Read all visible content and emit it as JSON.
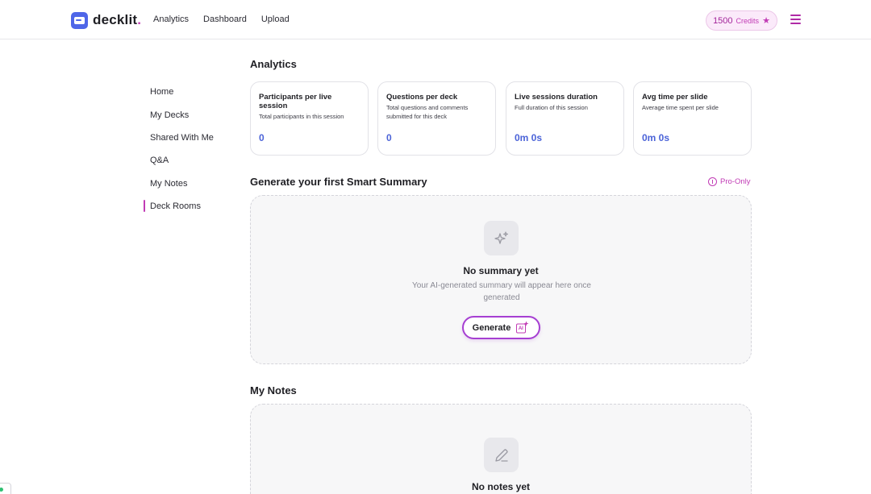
{
  "header": {
    "logo_text": "decklit",
    "logo_dot": ".",
    "nav": [
      "Analytics",
      "Dashboard",
      "Upload"
    ],
    "credits_value": "1500",
    "credits_label": "Credits"
  },
  "sidebar": {
    "items": [
      {
        "label": "Home"
      },
      {
        "label": "My Decks"
      },
      {
        "label": "Shared With Me"
      },
      {
        "label": "Q&A"
      },
      {
        "label": "My Notes"
      },
      {
        "label": "Deck Rooms"
      }
    ],
    "active_index": 5
  },
  "analytics": {
    "title": "Analytics",
    "cards": [
      {
        "title": "Participants per live session",
        "desc": "Total participants in this session",
        "value": "0"
      },
      {
        "title": "Questions per deck",
        "desc": "Total questions and comments submitted for this deck",
        "value": "0"
      },
      {
        "title": "Live sessions duration",
        "desc": "Full duration of this session",
        "value": "0m 0s"
      },
      {
        "title": "Avg time per slide",
        "desc": "Average time spent per slide",
        "value": "0m 0s"
      }
    ]
  },
  "summary": {
    "title": "Generate your first Smart Summary",
    "pro_label": "Pro-Only",
    "empty_heading": "No summary yet",
    "empty_text": "Your AI-generated summary will appear here once generated",
    "button_label": "Generate",
    "button_badge": "AI"
  },
  "notes": {
    "title": "My Notes",
    "empty_heading": "No notes yet"
  },
  "colors": {
    "accent": "#c13bb5",
    "brand_blue": "#4f66e8",
    "value_blue": "#4b63d8"
  }
}
